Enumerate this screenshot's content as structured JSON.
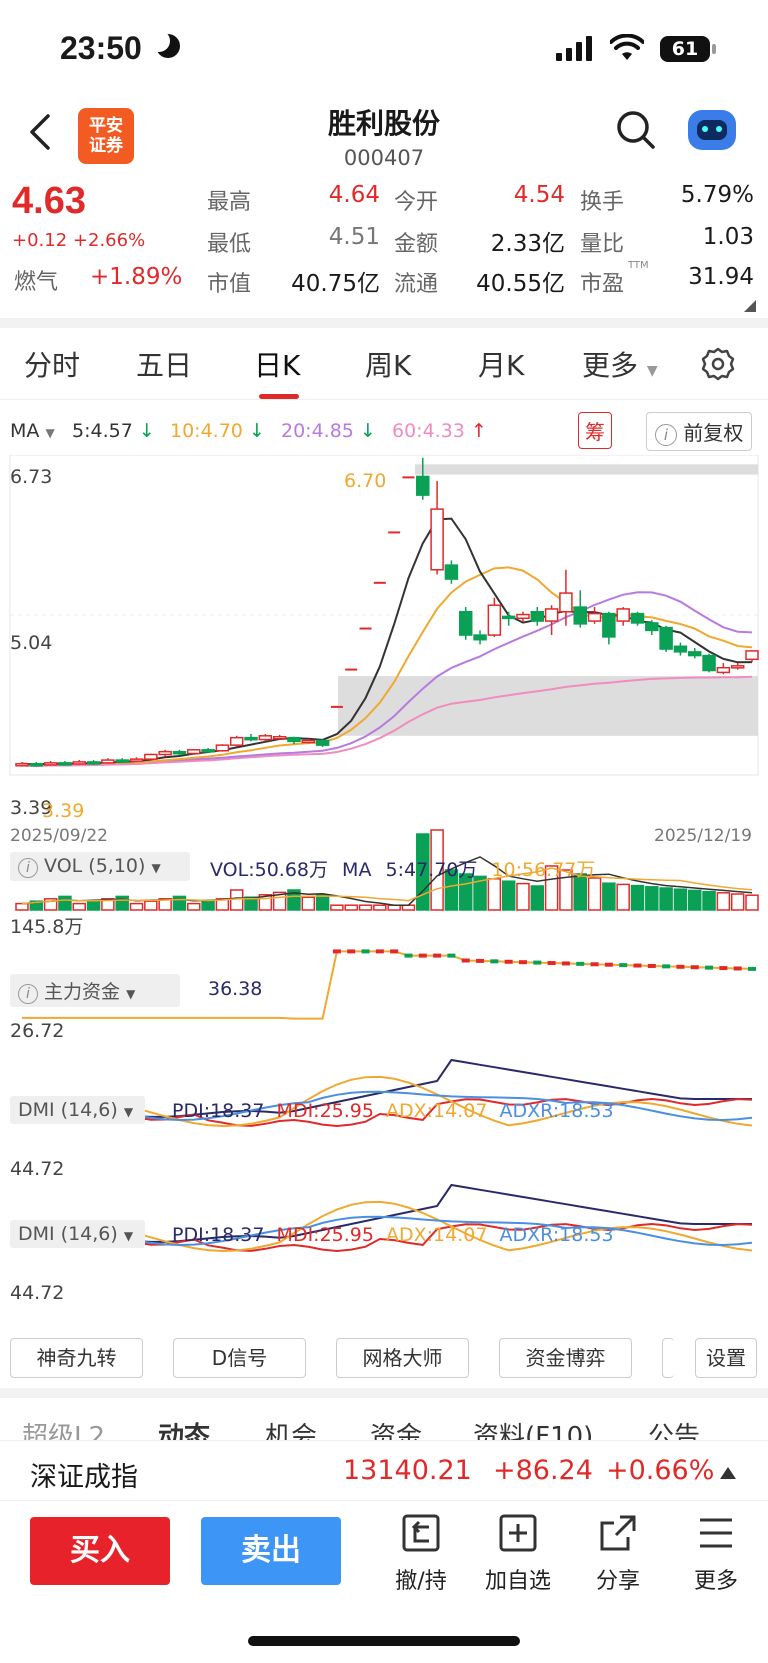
{
  "status_bar": {
    "time": "23:50",
    "battery": "61"
  },
  "header": {
    "title": "胜利股份",
    "code": "000407",
    "broker_logo_line1": "平安",
    "broker_logo_line2": "证券"
  },
  "quote": {
    "price": "4.63",
    "change": "+0.12",
    "change_pct": "+2.66%",
    "sector_name": "燃气",
    "sector_change": "+1.89%",
    "high_label": "最高",
    "high": "4.64",
    "low_label": "最低",
    "low": "4.51",
    "mktcap_label": "市值",
    "mktcap": "40.75亿",
    "open_label": "今开",
    "open": "4.54",
    "amount_label": "金额",
    "amount": "2.33亿",
    "float_label": "流通",
    "float": "40.55亿",
    "turnover_label": "换手",
    "turnover": "5.79%",
    "vol_ratio_label": "量比",
    "vol_ratio": "1.03",
    "pe_label": "市盈",
    "pe_sup": "TTM",
    "pe": "31.94"
  },
  "tabs": [
    "分时",
    "五日",
    "日K",
    "周K",
    "月K",
    "更多"
  ],
  "active_tab": "日K",
  "ma_row": {
    "ma_label": "MA",
    "ma5": "5:4.57",
    "ma10": "10:4.70",
    "ma20": "20:4.85",
    "ma60": "60:4.33",
    "chip_label": "筹",
    "adjust_label": "前复权"
  },
  "colors": {
    "up": "#e02a2a",
    "down": "#0aa055",
    "ma5": "#333333",
    "ma10": "#f0a830",
    "ma20": "#b77be0",
    "ma60": "#f08cc0",
    "accent_buy": "#e8222a",
    "accent_sell": "#3d95f5"
  },
  "chart_data": [
    {
      "type": "candlestick",
      "title": "",
      "y_ticks": [
        "6.73",
        "5.04",
        "3.39"
      ],
      "ylim": [
        3.3,
        6.73
      ],
      "x_start_label": "2025/09/22",
      "x_end_label": "2025/12/19",
      "max_annotation": "6.70",
      "min_annotation": "3.39",
      "candles": [
        {
          "o": 3.4,
          "c": 3.42,
          "h": 3.44,
          "l": 3.39
        },
        {
          "o": 3.42,
          "c": 3.41,
          "h": 3.44,
          "l": 3.39
        },
        {
          "o": 3.41,
          "c": 3.43,
          "h": 3.45,
          "l": 3.4
        },
        {
          "o": 3.43,
          "c": 3.42,
          "h": 3.45,
          "l": 3.4
        },
        {
          "o": 3.42,
          "c": 3.44,
          "h": 3.46,
          "l": 3.41
        },
        {
          "o": 3.44,
          "c": 3.43,
          "h": 3.46,
          "l": 3.41
        },
        {
          "o": 3.43,
          "c": 3.46,
          "h": 3.48,
          "l": 3.42
        },
        {
          "o": 3.46,
          "c": 3.45,
          "h": 3.48,
          "l": 3.44
        },
        {
          "o": 3.45,
          "c": 3.47,
          "h": 3.49,
          "l": 3.44
        },
        {
          "o": 3.47,
          "c": 3.52,
          "h": 3.53,
          "l": 3.46
        },
        {
          "o": 3.52,
          "c": 3.55,
          "h": 3.57,
          "l": 3.5
        },
        {
          "o": 3.55,
          "c": 3.53,
          "h": 3.57,
          "l": 3.51
        },
        {
          "o": 3.53,
          "c": 3.57,
          "h": 3.58,
          "l": 3.52
        },
        {
          "o": 3.57,
          "c": 3.56,
          "h": 3.59,
          "l": 3.54
        },
        {
          "o": 3.56,
          "c": 3.62,
          "h": 3.63,
          "l": 3.55
        },
        {
          "o": 3.62,
          "c": 3.7,
          "h": 3.72,
          "l": 3.6
        },
        {
          "o": 3.7,
          "c": 3.68,
          "h": 3.74,
          "l": 3.66
        },
        {
          "o": 3.68,
          "c": 3.72,
          "h": 3.74,
          "l": 3.66
        },
        {
          "o": 3.7,
          "c": 3.71,
          "h": 3.73,
          "l": 3.68
        },
        {
          "o": 3.7,
          "c": 3.66,
          "h": 3.71,
          "l": 3.63
        },
        {
          "o": 3.66,
          "c": 3.67,
          "h": 3.69,
          "l": 3.64
        },
        {
          "o": 3.67,
          "c": 3.62,
          "h": 3.68,
          "l": 3.6
        },
        {
          "o": 4.03,
          "c": 4.03,
          "h": 4.03,
          "l": 4.03
        },
        {
          "o": 4.43,
          "c": 4.43,
          "h": 4.43,
          "l": 4.43
        },
        {
          "o": 4.87,
          "c": 4.87,
          "h": 4.87,
          "l": 4.87
        },
        {
          "o": 5.36,
          "c": 5.36,
          "h": 5.36,
          "l": 5.36
        },
        {
          "o": 5.9,
          "c": 5.9,
          "h": 5.9,
          "l": 5.9
        },
        {
          "o": 6.49,
          "c": 6.49,
          "h": 6.49,
          "l": 6.49
        },
        {
          "o": 6.5,
          "c": 6.3,
          "h": 6.7,
          "l": 6.25
        },
        {
          "o": 5.5,
          "c": 6.15,
          "h": 6.45,
          "l": 5.45
        },
        {
          "o": 5.55,
          "c": 5.4,
          "h": 5.6,
          "l": 5.35
        },
        {
          "o": 5.05,
          "c": 4.8,
          "h": 5.1,
          "l": 4.75
        },
        {
          "o": 4.8,
          "c": 4.75,
          "h": 4.85,
          "l": 4.7
        },
        {
          "o": 4.8,
          "c": 5.12,
          "h": 5.2,
          "l": 4.78
        },
        {
          "o": 5.0,
          "c": 4.98,
          "h": 5.05,
          "l": 4.9
        },
        {
          "o": 4.98,
          "c": 5.02,
          "h": 5.05,
          "l": 4.94
        },
        {
          "o": 5.05,
          "c": 4.95,
          "h": 5.1,
          "l": 4.9
        },
        {
          "o": 4.95,
          "c": 5.08,
          "h": 5.12,
          "l": 4.8
        },
        {
          "o": 5.05,
          "c": 5.25,
          "h": 5.5,
          "l": 4.9
        },
        {
          "o": 5.1,
          "c": 4.92,
          "h": 5.28,
          "l": 4.88
        },
        {
          "o": 4.95,
          "c": 5.03,
          "h": 5.1,
          "l": 4.92
        },
        {
          "o": 5.03,
          "c": 4.78,
          "h": 5.05,
          "l": 4.7
        },
        {
          "o": 4.95,
          "c": 5.08,
          "h": 5.1,
          "l": 4.9
        },
        {
          "o": 5.03,
          "c": 4.93,
          "h": 5.05,
          "l": 4.9
        },
        {
          "o": 4.93,
          "c": 4.85,
          "h": 4.96,
          "l": 4.8
        },
        {
          "o": 4.88,
          "c": 4.65,
          "h": 4.9,
          "l": 4.62
        },
        {
          "o": 4.68,
          "c": 4.62,
          "h": 4.72,
          "l": 4.58
        },
        {
          "o": 4.62,
          "c": 4.58,
          "h": 4.66,
          "l": 4.55
        },
        {
          "o": 4.58,
          "c": 4.42,
          "h": 4.6,
          "l": 4.4
        },
        {
          "o": 4.4,
          "c": 4.45,
          "h": 4.5,
          "l": 4.38
        },
        {
          "o": 4.45,
          "c": 4.47,
          "h": 4.5,
          "l": 4.43
        },
        {
          "o": 4.54,
          "c": 4.63,
          "h": 4.64,
          "l": 4.51
        }
      ]
    },
    {
      "type": "bar",
      "title": "VOL (5,10)",
      "y_tick": "145.8万",
      "readout": {
        "vol": "VOL:50.68万",
        "ma_label": "MA",
        "ma5": "5:47.70万",
        "ma10": "10:56.77万"
      }
    },
    {
      "type": "line",
      "title": "主力资金",
      "readout": "36.38",
      "y_tick": "26.72"
    },
    {
      "type": "line",
      "title": "DMI (14,6)",
      "y_tick": "44.72",
      "series": [
        {
          "name": "PDI:18.37"
        },
        {
          "name": "MDI:25.95"
        },
        {
          "name": "ADX:14.07"
        },
        {
          "name": "ADXR:18.53"
        }
      ]
    }
  ],
  "indicator_buttons": [
    "神奇九转",
    "D信号",
    "网格大师",
    "资金博弈",
    "设置"
  ],
  "sub_tabs": [
    "超级L2",
    "动态",
    "机会",
    "资金",
    "资料(F10)",
    "公告"
  ],
  "index_bar": {
    "name": "深证成指",
    "value": "13140.21",
    "change": "+86.24",
    "change_pct": "+0.66%"
  },
  "bottom": {
    "buy": "买入",
    "sell": "卖出",
    "actions": [
      "撤/持",
      "加自选",
      "分享",
      "更多"
    ]
  }
}
